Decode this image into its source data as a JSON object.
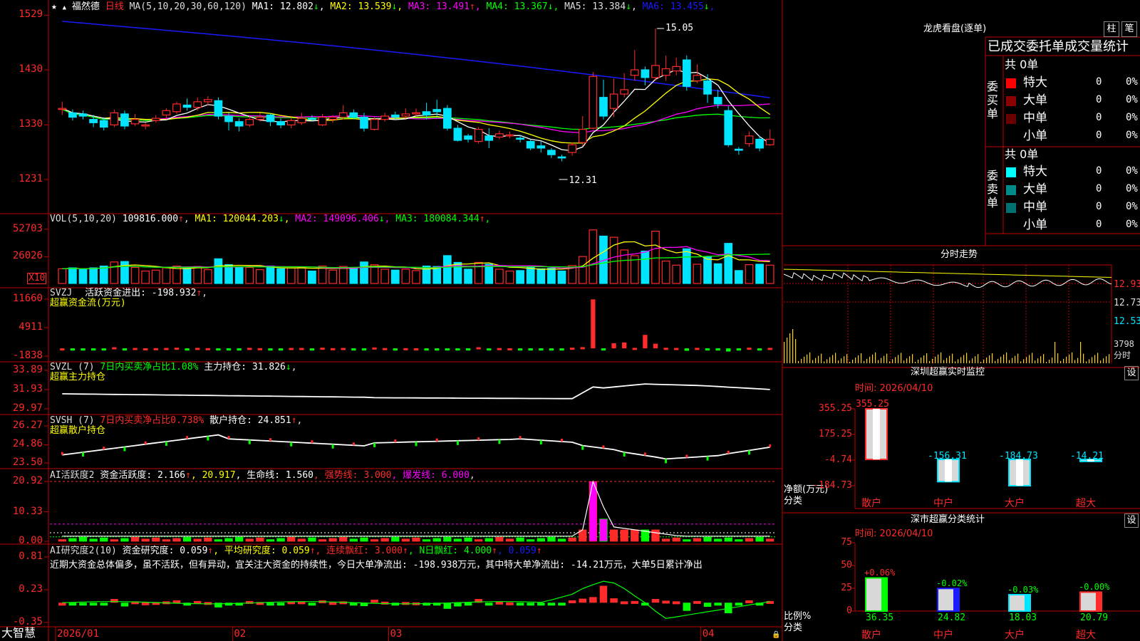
{
  "colors": {
    "up": "#ff2a2a",
    "down": "#00e5ff",
    "grid": "#c00000",
    "yellow": "#ffff00",
    "magenta": "#ff00ff",
    "green": "#00ff00",
    "blue": "#1a1aff",
    "white": "#ffffff"
  },
  "header": {
    "star": "★",
    "up_marker": "▲",
    "stock_name": "福然德",
    "period": "日线",
    "ma_params": "MA(5,10,20,30,60,120)",
    "ma": [
      {
        "label": "MA1: 12.802",
        "arrow": "↓",
        "color": "#ffffff"
      },
      {
        "label": "MA2: 13.539",
        "arrow": "↓",
        "color": "#ffff00"
      },
      {
        "label": "MA3: 13.491",
        "arrow": "↑",
        "color": "#ff00ff"
      },
      {
        "label": "MA4: 13.367",
        "arrow": "↓",
        "color": "#00ff00"
      },
      {
        "label": "MA5: 13.384",
        "arrow": "↓",
        "color": "#dddddd"
      },
      {
        "label": "MA6: 13.455",
        "arrow": "↓",
        "color": "#1a1aff"
      }
    ]
  },
  "price_axis": [
    "1529",
    "1430",
    "1330",
    "1231"
  ],
  "price_annotations": {
    "high": "15.05",
    "low": "12.31"
  },
  "vol": {
    "axis": [
      "52703",
      "26026",
      "X10"
    ],
    "title": "VOL(5,10,20)",
    "value": "109816.000",
    "value_arrow": "↑",
    "ma": [
      {
        "label": "MA1: 120044.203",
        "arrow": "↓",
        "color": "#ffff00"
      },
      {
        "label": "MA2: 149096.406",
        "arrow": "↓",
        "color": "#ff00ff"
      },
      {
        "label": "MA3: 180084.344",
        "arrow": "↑",
        "color": "#00ff00"
      }
    ]
  },
  "svzj": {
    "axis": [
      "11660",
      "4911",
      "-1838"
    ],
    "title": "SVZJ",
    "label": "活跃资金进出: -198.932",
    "arrow": "↑",
    "sub": "超赢资金流(万元)"
  },
  "svzl": {
    "axis": [
      "33.89",
      "31.93",
      "29.97"
    ],
    "title": "SVZL (7)",
    "ratio": "7日内买卖净占比1.08%",
    "label": "主力持仓: 31.826",
    "arrow": "↓",
    "sub": "超赢主力持仓"
  },
  "svsh": {
    "axis": [
      "26.27",
      "24.86",
      "23.50"
    ],
    "title": "SVSH (7)",
    "ratio": "7日内买卖净占比0.738%",
    "label": "散户持仓: 24.851",
    "arrow": "↑",
    "sub": "超赢散户持仓"
  },
  "ai_active": {
    "axis": [
      "20.92",
      "10.33",
      "0.00"
    ],
    "title": "AI活跃度2",
    "label1": "资金活跃度: 2.166",
    "arrow1": "↑",
    "label2": ", 20.917",
    "label3": ", 生命线: 1.560",
    "label4": ", 强势线: 3.000",
    "label5": ", 爆发线: 6.000",
    "tail": ","
  },
  "ai_research": {
    "axis": [
      "0.81",
      "0.23",
      "-0.35"
    ],
    "title": "AI研究度2(10)",
    "label1": "资金研究度: 0.059",
    "arrow1": "↑",
    "label2": ", 平均研究度: 0.059",
    "arrow2": "↑",
    "label3": ", 连续飘红: 3.000",
    "arrow3": "↑",
    "label4": ", N日飘红: 4.000",
    "arrow4": "↑",
    "label5": ", 0.059",
    "arrow5": "↑",
    "note": "近期大资金总体偏多，虽不活跃，但有异动，宜关注大资金的持续性，今日大单净流出: -198.938万元，其中特大单净流出: -14.21万元，大单5日累计净出"
  },
  "date_axis": {
    "brand": "大智慧",
    "dates": [
      "2026/01",
      "02",
      "03",
      "04"
    ]
  },
  "lhb": {
    "title": "龙虎看盘(逐单)",
    "btn_zhu": "柱",
    "btn_bi": "笔",
    "tabs": [
      "已成交",
      "委托单",
      "成交量统计"
    ],
    "buy_label": "委买单",
    "sell_label": "委卖单",
    "buy_total": "共 0单",
    "sell_total": "共 0单",
    "buy_rows": [
      {
        "name": "特大",
        "count": "0",
        "pct": "0%",
        "color": "#ff0000"
      },
      {
        "name": "大单",
        "count": "0",
        "pct": "0%",
        "color": "#8b0000"
      },
      {
        "name": "中单",
        "count": "0",
        "pct": "0%",
        "color": "#6a0000"
      },
      {
        "name": "小单",
        "count": "0",
        "pct": "0%",
        "color": "#000000"
      }
    ],
    "sell_rows": [
      {
        "name": "特大",
        "count": "0",
        "pct": "0%",
        "color": "#00ffff"
      },
      {
        "name": "大单",
        "count": "0",
        "pct": "0%",
        "color": "#008b8b"
      },
      {
        "name": "中单",
        "count": "0",
        "pct": "0%",
        "color": "#007070"
      },
      {
        "name": "小单",
        "count": "0",
        "pct": "0%",
        "color": "#000000"
      }
    ]
  },
  "intraday": {
    "title": "分时走势",
    "price_labels": [
      "12.93",
      "12.73",
      "12.53"
    ],
    "vol_label": "3798",
    "time_label": "分时"
  },
  "monitor": {
    "title": "深圳超赢实时监控",
    "btn": "设",
    "time": "时间: 2026/04/10",
    "axis": [
      "355.25",
      "175.25",
      "-4.74",
      "-184.73"
    ],
    "ylabel": "净额(万元)",
    "xlabel": "分类",
    "bars": [
      {
        "cat": "散户",
        "value": 355.25,
        "label": "355.25"
      },
      {
        "cat": "中户",
        "value": -156.31,
        "label": "-156.31"
      },
      {
        "cat": "大户",
        "value": -184.73,
        "label": "-184.73"
      },
      {
        "cat": "超大",
        "value": -14.21,
        "label": "-14.21"
      }
    ]
  },
  "classify": {
    "title": "深市超赢分类统计",
    "btn": "设",
    "time": "时间: 2026/04/10",
    "axis": [
      "75",
      "50",
      "25",
      "0"
    ],
    "ylabel": "比例%",
    "xlabel": "分类",
    "bars": [
      {
        "cat": "散户",
        "value": 36.35,
        "label": "36.35",
        "delta": "+0.06%",
        "color": "#00ff00"
      },
      {
        "cat": "中户",
        "value": 24.82,
        "label": "24.82",
        "delta": "-0.02%",
        "color": "#1a1aff"
      },
      {
        "cat": "大户",
        "value": 18.03,
        "label": "18.03",
        "delta": "-0.03%",
        "color": "#00e5ff"
      },
      {
        "cat": "超大",
        "value": 20.79,
        "label": "20.79",
        "delta": "-0.00%",
        "color": "#ff2a2a"
      }
    ]
  },
  "chart_data": {
    "type": "candlestick",
    "ylim": [
      12.31,
      15.29
    ],
    "candles": [
      [
        13.6,
        13.6,
        13.72,
        13.48
      ],
      [
        13.52,
        13.44,
        13.58,
        13.38
      ],
      [
        13.5,
        13.46,
        13.56,
        13.4
      ],
      [
        13.4,
        13.34,
        13.48,
        13.26
      ],
      [
        13.38,
        13.26,
        13.44,
        13.2
      ],
      [
        13.3,
        13.52,
        13.58,
        13.26
      ],
      [
        13.5,
        13.28,
        13.56,
        13.22
      ],
      [
        13.32,
        13.4,
        13.5,
        13.28
      ],
      [
        13.28,
        13.3,
        13.34,
        13.22
      ],
      [
        13.38,
        13.42,
        13.48,
        13.34
      ],
      [
        13.48,
        13.56,
        13.6,
        13.4
      ],
      [
        13.54,
        13.68,
        13.72,
        13.5
      ],
      [
        13.66,
        13.62,
        13.78,
        13.56
      ],
      [
        13.62,
        13.72,
        13.8,
        13.56
      ],
      [
        13.72,
        13.76,
        13.82,
        13.66
      ],
      [
        13.74,
        13.46,
        13.8,
        13.4
      ],
      [
        13.46,
        13.36,
        13.52,
        13.2
      ],
      [
        13.36,
        13.28,
        13.42,
        13.18
      ],
      [
        13.3,
        13.4,
        13.46,
        13.26
      ],
      [
        13.4,
        13.44,
        13.52,
        13.36
      ],
      [
        13.48,
        13.36,
        13.52,
        13.28
      ],
      [
        13.36,
        13.3,
        13.42,
        13.24
      ],
      [
        13.3,
        13.38,
        13.44,
        13.24
      ],
      [
        13.34,
        13.42,
        13.52,
        13.3
      ],
      [
        13.42,
        13.4,
        13.48,
        13.36
      ],
      [
        13.3,
        13.44,
        13.5,
        13.28
      ],
      [
        13.4,
        13.44,
        13.48,
        13.34
      ],
      [
        13.44,
        13.52,
        13.66,
        13.4
      ],
      [
        13.52,
        13.44,
        13.58,
        13.4
      ],
      [
        13.44,
        13.24,
        13.52,
        13.18
      ],
      [
        13.22,
        13.4,
        13.44,
        13.2
      ],
      [
        13.4,
        13.46,
        13.52,
        13.36
      ],
      [
        13.48,
        13.44,
        13.54,
        13.4
      ],
      [
        13.46,
        13.5,
        13.6,
        13.42
      ],
      [
        13.5,
        13.52,
        13.6,
        13.46
      ],
      [
        13.54,
        13.48,
        13.7,
        13.4
      ],
      [
        13.58,
        13.54,
        13.76,
        13.46
      ],
      [
        13.6,
        13.24,
        13.66,
        13.2
      ],
      [
        13.24,
        13.02,
        13.3,
        13.0
      ],
      [
        13.1,
        13.04,
        13.14,
        12.98
      ],
      [
        13.0,
        13.22,
        13.26,
        12.96
      ],
      [
        13.1,
        13.02,
        13.24,
        12.88
      ],
      [
        13.08,
        13.14,
        13.2,
        13.04
      ],
      [
        13.1,
        13.12,
        13.18,
        13.06
      ],
      [
        13.06,
        13.04,
        13.12,
        12.98
      ],
      [
        13.0,
        12.88,
        13.04,
        12.84
      ],
      [
        12.92,
        12.88,
        13.0,
        12.8
      ],
      [
        12.84,
        12.76,
        12.88,
        12.7
      ],
      [
        12.72,
        12.7,
        12.76,
        12.64
      ],
      [
        12.8,
        12.94,
        12.98,
        12.74
      ],
      [
        12.98,
        13.22,
        13.46,
        12.92
      ],
      [
        13.24,
        14.18,
        14.26,
        13.22
      ],
      [
        13.8,
        13.46,
        14.12,
        13.4
      ],
      [
        13.6,
        13.86,
        14.14,
        13.44
      ],
      [
        13.86,
        13.94,
        14.24,
        13.8
      ],
      [
        14.2,
        14.3,
        14.66,
        14.1
      ],
      [
        14.3,
        14.16,
        14.36,
        14.02
      ],
      [
        14.16,
        14.38,
        15.05,
        14.1
      ],
      [
        14.2,
        14.32,
        14.56,
        14.1
      ],
      [
        14.28,
        14.36,
        14.52,
        14.2
      ],
      [
        14.48,
        14.0,
        14.56,
        13.92
      ],
      [
        14.1,
        14.2,
        14.4,
        14.06
      ],
      [
        14.1,
        13.86,
        14.22,
        13.7
      ],
      [
        13.8,
        13.68,
        13.94,
        13.6
      ],
      [
        13.56,
        12.94,
        13.64,
        12.9
      ],
      [
        12.86,
        12.84,
        12.9,
        12.76
      ],
      [
        12.96,
        13.1,
        13.18,
        12.9
      ],
      [
        13.04,
        12.88,
        13.1,
        12.82
      ],
      [
        12.94,
        13.04,
        13.22,
        12.92
      ]
    ]
  }
}
